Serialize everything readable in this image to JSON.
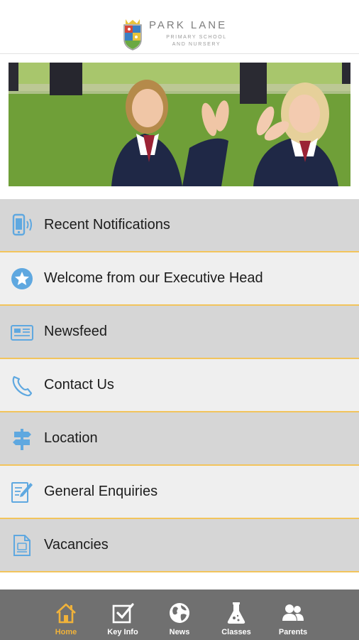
{
  "header": {
    "school_name": "PARK LANE",
    "subtitle_line1": "PRIMARY SCHOOL",
    "subtitle_line2": "AND NURSERY"
  },
  "hero": {
    "alt": "Two pupils clapping on the school field"
  },
  "menu": {
    "items": [
      {
        "label": "Recent Notifications",
        "icon": "phone-notification-icon"
      },
      {
        "label": "Welcome from our Executive Head",
        "icon": "star-icon"
      },
      {
        "label": "Newsfeed",
        "icon": "newspaper-icon"
      },
      {
        "label": "Contact Us",
        "icon": "telephone-icon"
      },
      {
        "label": "Location",
        "icon": "signpost-icon"
      },
      {
        "label": "General Enquiries",
        "icon": "pencil-form-icon"
      },
      {
        "label": "Vacancies",
        "icon": "cv-document-icon"
      }
    ]
  },
  "tabbar": {
    "tabs": [
      {
        "label": "Home",
        "icon": "home-icon",
        "active": true
      },
      {
        "label": "Key Info",
        "icon": "checkbox-icon",
        "active": false
      },
      {
        "label": "News",
        "icon": "globe-icon",
        "active": false
      },
      {
        "label": "Classes",
        "icon": "flask-icon",
        "active": false
      },
      {
        "label": "Parents",
        "icon": "people-icon",
        "active": false
      }
    ]
  },
  "colors": {
    "accent": "#f0b23a",
    "divider": "#f2c45c",
    "icon_blue": "#5fa8e0",
    "tabbar": "#707070"
  }
}
